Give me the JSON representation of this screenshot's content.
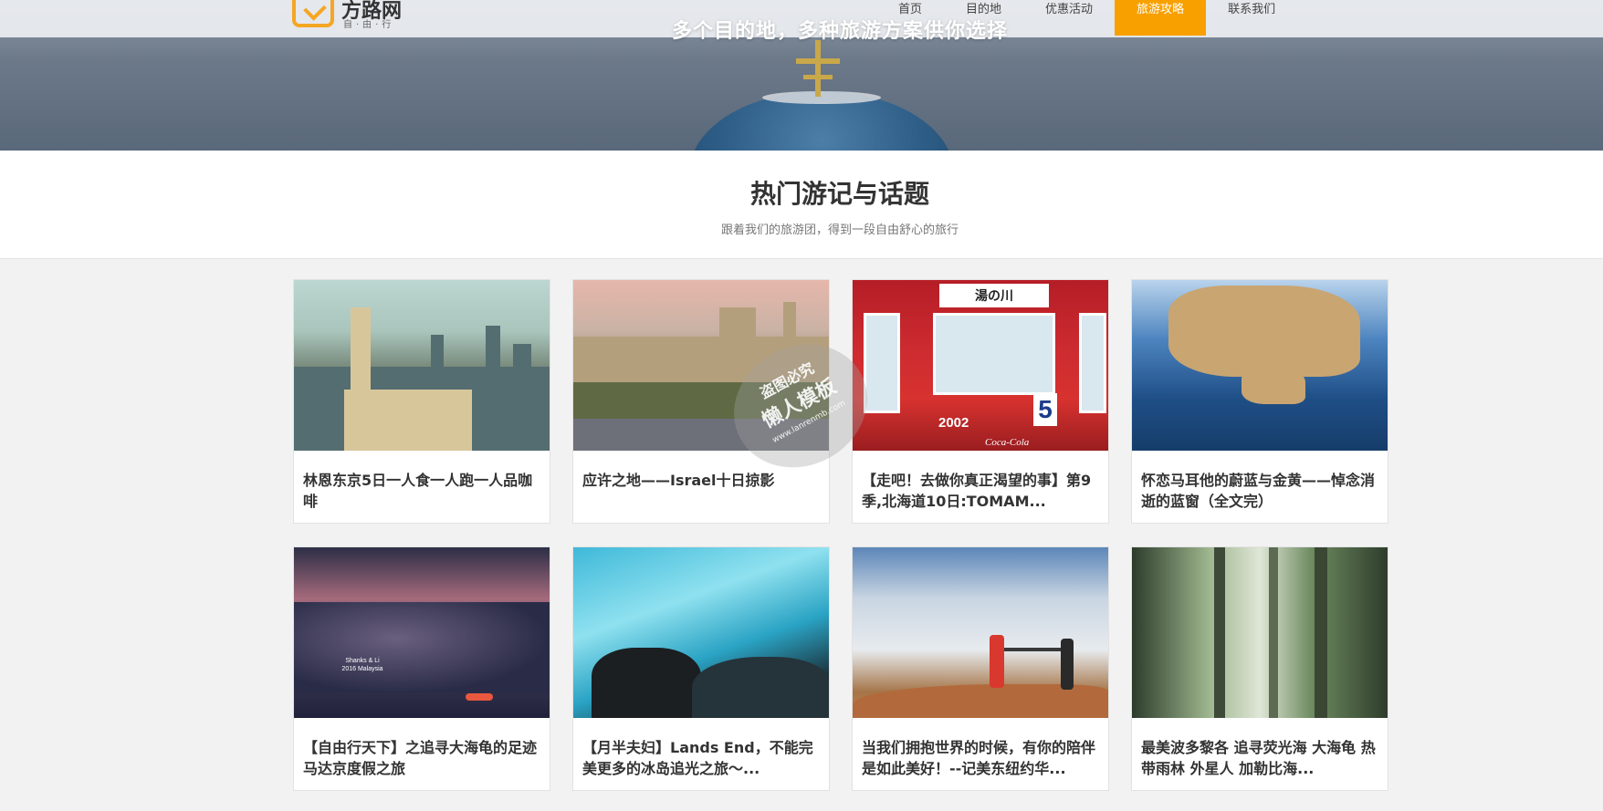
{
  "header": {
    "logo_text": "方路网",
    "logo_sub": "自·由·行",
    "nav": [
      {
        "label": "首页"
      },
      {
        "label": "目的地"
      },
      {
        "label": "优惠活动"
      },
      {
        "label": "旅游攻略"
      },
      {
        "label": "联系我们"
      }
    ],
    "active_nav_index": 3,
    "accent_color": "#f8a000"
  },
  "hero": {
    "slogan": "多个目的地，多种旅游方案供你选择"
  },
  "section": {
    "title": "热门游记与话题",
    "subtitle": "跟着我们的旅游团，得到一段自由舒心的旅行"
  },
  "cards": [
    {
      "title": "林恩东京5日一人食一人跑一人品咖啡"
    },
    {
      "title": "应许之地——Israel十日掠影"
    },
    {
      "title": "【走吧！去做你真正渴望的事】第9季,北海道10日:TOMAM..."
    },
    {
      "title": "怀恋马耳他的蔚蓝与金黄——悼念消逝的蓝窗（全文完）"
    },
    {
      "title": "【自由行天下】之追寻大海龟的足迹马达京度假之旅"
    },
    {
      "title": "【月半夫妇】Lands End，不能完美更多的冰岛追光之旅～..."
    },
    {
      "title": "当我们拥抱世界的时候，有你的陪伴是如此美好！--记美东纽约华..."
    },
    {
      "title": "最美波多黎各 追寻荧光海 大海龟 热带雨林 外星人 加勒比海..."
    }
  ],
  "image_text": {
    "train_sign": "湯の川",
    "train_number": "5",
    "train_id": "2002",
    "train_brand": "Coca-Cola",
    "photo_caption_1": "Shanks & Li",
    "photo_caption_2": "2016 Malaysia"
  },
  "watermark": {
    "line1": "盗图必究",
    "line2": "懒人模板",
    "line3": "www.lanrenmb.com"
  }
}
